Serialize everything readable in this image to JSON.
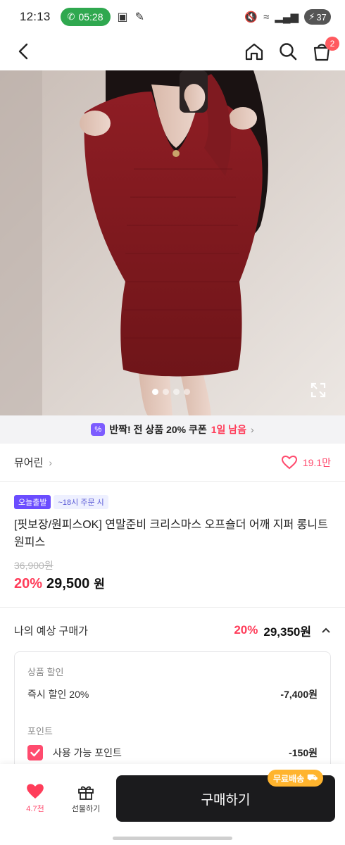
{
  "status_bar": {
    "time": "12:13",
    "call_time": "05:28",
    "battery": "37"
  },
  "nav": {
    "cart_count": "2"
  },
  "hero": {
    "image_alt": "product photo",
    "slide_count": 4,
    "active_slide": 1
  },
  "coupon": {
    "prefix": "반짝! 전 상품 20% 쿠폰",
    "remaining": "1일 남음"
  },
  "shop": {
    "name": "뮤어린",
    "likes": "19.1만"
  },
  "product": {
    "badge_today": "오늘출발",
    "badge_time": "~18시 주문 시",
    "title": "[핏보장/원피스OK] 연말준비 크리스마스 오프숄더 어깨 지퍼 롱니트 원피스",
    "original_price": "36,900원",
    "discount_pct": "20%",
    "price": "29,500",
    "currency": "원"
  },
  "expected": {
    "label": "나의 예상 구매가",
    "discount_pct": "20%",
    "price": "29,350원"
  },
  "breakdown": {
    "section1": "상품 할인",
    "row1_label": "즉시 할인 20%",
    "row1_value": "-7,400원",
    "section2": "포인트",
    "row2_label": "사용 가능 포인트",
    "row2_value": "-150원"
  },
  "bottom": {
    "likes_count": "4.7천",
    "gift_label": "선물하기",
    "buy_label": "구매하기",
    "free_shipping": "무료배송"
  },
  "colors": {
    "accent_red": "#ff3d5a",
    "accent_purple": "#6b4dff",
    "buy_button": "#1b1b1d",
    "free_ship": "#ffb42e"
  }
}
